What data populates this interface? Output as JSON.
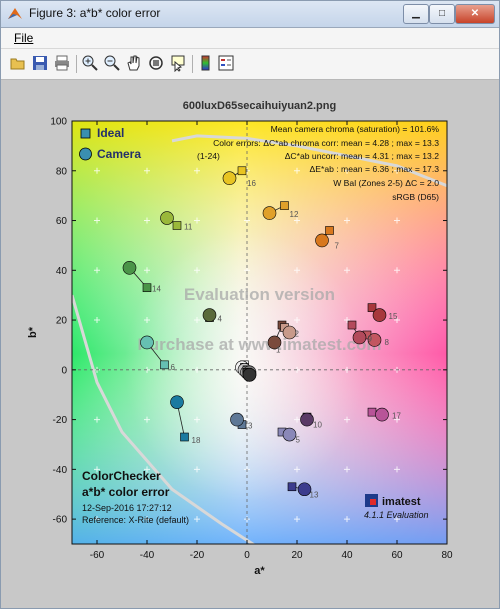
{
  "window": {
    "title": "Figure 3: a*b* color error",
    "minimize": "▁",
    "maximize": "□",
    "close": "✕"
  },
  "menu": {
    "file": "File"
  },
  "toolbar": {
    "icons": [
      "open-icon",
      "save-icon",
      "print-icon",
      "zoom-in-icon",
      "zoom-out-icon",
      "pan-icon",
      "rotate-icon",
      "data-cursor-icon",
      "colorbar-icon",
      "legend-icon"
    ]
  },
  "chart_data": {
    "type": "scatter",
    "title": "600luxD65secaihuiyuan2.png",
    "xlabel": "a*",
    "ylabel": "b*",
    "xlim": [
      -70,
      80
    ],
    "ylim": [
      -70,
      100
    ],
    "xticks": [
      -60,
      -40,
      -20,
      0,
      20,
      40,
      60,
      80
    ],
    "yticks": [
      -60,
      -40,
      -20,
      0,
      20,
      40,
      60,
      80,
      100
    ],
    "legend": {
      "placement": "top-left",
      "entries": [
        "Ideal",
        "Camera"
      ]
    },
    "annotations": {
      "line1": "Mean camera chroma (saturation) = 101.6%",
      "line2": "Color errors: ΔC*ab chroma corr:  mean = 4.28 ;  max = 13.3",
      "line3_left": "(1-24)",
      "line3": "ΔC*ab uncorr:  mean = 4.31 ;  max = 13.2",
      "line4": "ΔE*ab :  mean = 6.36 ;  max = 17.3",
      "line5": "W Bal (Zones 2-5) ΔC = 2.0",
      "line6": "sRGB (D65)"
    },
    "bottom_left": {
      "line1": "ColorChecker",
      "line2": "a*b* color error",
      "line3": "12-Sep-2016 17:27:12",
      "line4": "Reference: X-Rite (default)"
    },
    "watermark1": "Evaluation version",
    "watermark2": "Purchase at www.imatest.com",
    "brand": "imatest",
    "version": "4.1.1  Evaluation",
    "patches": [
      {
        "id": 1,
        "ideal": [
          14,
          18
        ],
        "camera": [
          11,
          11
        ],
        "color": "#7a4a3c"
      },
      {
        "id": 2,
        "ideal": [
          15,
          17
        ],
        "camera": [
          17,
          15
        ],
        "color": "#c89a8a"
      },
      {
        "id": 3,
        "ideal": [
          -2,
          -22
        ],
        "camera": [
          -4,
          -20
        ],
        "color": "#5e7896"
      },
      {
        "id": 4,
        "ideal": [
          -15,
          21
        ],
        "camera": [
          -15,
          22
        ],
        "color": "#5a6a3a"
      },
      {
        "id": 5,
        "ideal": [
          14,
          -25
        ],
        "camera": [
          17,
          -26
        ],
        "color": "#8a88b8"
      },
      {
        "id": 6,
        "ideal": [
          -33,
          2
        ],
        "camera": [
          -40,
          11
        ],
        "color": "#66c0b2"
      },
      {
        "id": 7,
        "ideal": [
          33,
          56
        ],
        "camera": [
          30,
          52
        ],
        "color": "#d8781e"
      },
      {
        "id": 8,
        "ideal": [
          48,
          14
        ],
        "camera": [
          51,
          12
        ],
        "color": "#c25660"
      },
      {
        "id": 9,
        "ideal": [
          42,
          18
        ],
        "camera": [
          45,
          13
        ],
        "color": "#b34a5c"
      },
      {
        "id": 10,
        "ideal": [
          24,
          -19
        ],
        "camera": [
          24,
          -20
        ],
        "color": "#5a3a66"
      },
      {
        "id": 11,
        "ideal": [
          -28,
          58
        ],
        "camera": [
          -32,
          61
        ],
        "color": "#9ab83a"
      },
      {
        "id": 12,
        "ideal": [
          15,
          66
        ],
        "camera": [
          9,
          63
        ],
        "color": "#e0a02a"
      },
      {
        "id": 13,
        "ideal": [
          18,
          -47
        ],
        "camera": [
          23,
          -48
        ],
        "color": "#3c3c8e"
      },
      {
        "id": 14,
        "ideal": [
          -40,
          33
        ],
        "camera": [
          -47,
          41
        ],
        "color": "#4a9448"
      },
      {
        "id": 15,
        "ideal": [
          50,
          25
        ],
        "camera": [
          53,
          22
        ],
        "color": "#a8383c"
      },
      {
        "id": 16,
        "ideal": [
          -2,
          80
        ],
        "camera": [
          -7,
          77
        ],
        "color": "#e8c422"
      },
      {
        "id": 17,
        "ideal": [
          50,
          -17
        ],
        "camera": [
          54,
          -18
        ],
        "color": "#b85498"
      },
      {
        "id": 18,
        "ideal": [
          -25,
          -27
        ],
        "camera": [
          -28,
          -13
        ],
        "color": "#1a7aa0"
      },
      {
        "id": 19,
        "ideal": [
          -1,
          2
        ],
        "camera": [
          -2,
          1
        ],
        "color": "#f2f2f2"
      },
      {
        "id": 20,
        "ideal": [
          -1,
          1
        ],
        "camera": [
          -1,
          0
        ],
        "color": "#c8c8c8"
      },
      {
        "id": 21,
        "ideal": [
          0,
          0
        ],
        "camera": [
          0,
          -1
        ],
        "color": "#a0a0a0"
      },
      {
        "id": 22,
        "ideal": [
          0,
          -1
        ],
        "camera": [
          1,
          -1
        ],
        "color": "#7a7a7a"
      },
      {
        "id": 23,
        "ideal": [
          0,
          -1
        ],
        "camera": [
          1,
          -2
        ],
        "color": "#555555"
      },
      {
        "id": 24,
        "ideal": [
          0,
          -1
        ],
        "camera": [
          1,
          -2
        ],
        "color": "#333333"
      }
    ]
  }
}
